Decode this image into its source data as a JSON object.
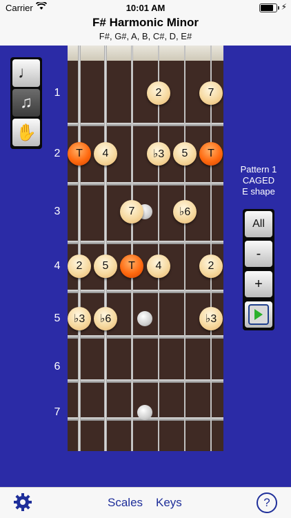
{
  "status": {
    "carrier": "Carrier",
    "time": "10:01 AM",
    "battery_level": 0.9
  },
  "header": {
    "title": "F# Harmonic Minor",
    "subtitle": "F#, G#, A, B, C#, D, E#"
  },
  "fret_labels": [
    "1",
    "2",
    "3",
    "4",
    "5",
    "6",
    "7"
  ],
  "mode_buttons": [
    {
      "icon": "single-note-icon",
      "glyph": "♩",
      "active": false
    },
    {
      "icon": "notes-icon",
      "glyph": "♫",
      "active": true
    },
    {
      "icon": "hand-icon",
      "glyph": "✋",
      "active": false
    }
  ],
  "pattern": {
    "name": "Pattern 1",
    "system": "CAGED",
    "shape": "E shape"
  },
  "controls": {
    "all": "All",
    "minus": "-",
    "plus": "+",
    "play_icon": "play-icon"
  },
  "notes": [
    {
      "fret": 1,
      "string": 4,
      "label": "2",
      "tonic": false
    },
    {
      "fret": 1,
      "string": 6,
      "label": "7",
      "tonic": false
    },
    {
      "fret": 2,
      "string": 1,
      "label": "T",
      "tonic": true
    },
    {
      "fret": 2,
      "string": 2,
      "label": "4",
      "tonic": false
    },
    {
      "fret": 2,
      "string": 4,
      "label": "♭3",
      "tonic": false
    },
    {
      "fret": 2,
      "string": 5,
      "label": "5",
      "tonic": false
    },
    {
      "fret": 2,
      "string": 6,
      "label": "T",
      "tonic": true
    },
    {
      "fret": 3,
      "string": 3,
      "label": "7",
      "tonic": false
    },
    {
      "fret": 3,
      "string": 5,
      "label": "♭6",
      "tonic": false
    },
    {
      "fret": 4,
      "string": 1,
      "label": "2",
      "tonic": false
    },
    {
      "fret": 4,
      "string": 2,
      "label": "5",
      "tonic": false
    },
    {
      "fret": 4,
      "string": 3,
      "label": "T",
      "tonic": true
    },
    {
      "fret": 4,
      "string": 4,
      "label": "4",
      "tonic": false
    },
    {
      "fret": 4,
      "string": 6,
      "label": "2",
      "tonic": false
    },
    {
      "fret": 5,
      "string": 1,
      "label": "♭3",
      "tonic": false
    },
    {
      "fret": 5,
      "string": 2,
      "label": "♭6",
      "tonic": false
    },
    {
      "fret": 5,
      "string": 6,
      "label": "♭3",
      "tonic": false
    }
  ],
  "inlay_frets": [
    3,
    5,
    7
  ],
  "bottom_bar": {
    "scales": "Scales",
    "keys": "Keys",
    "help": "?",
    "settings_icon": "gear-icon"
  }
}
